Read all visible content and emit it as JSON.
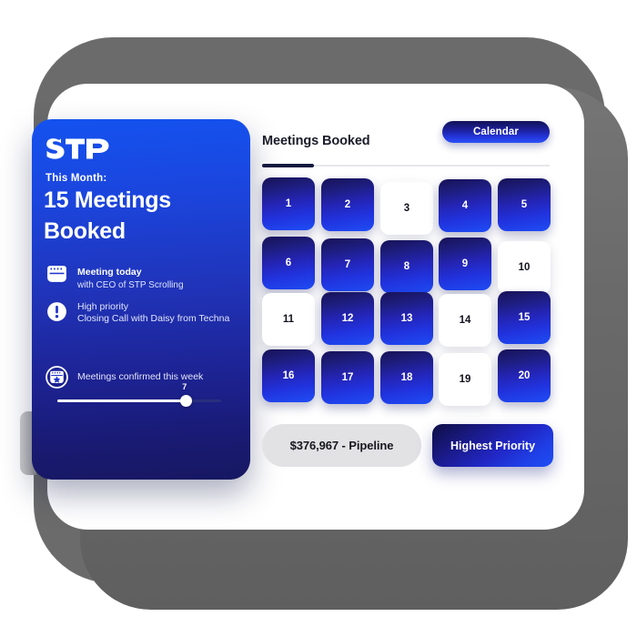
{
  "device": {
    "side_button_name": "power-button"
  },
  "sidebar": {
    "logo_text": "STP",
    "eyebrow": "This Month:",
    "headline": "15 Meetings Booked",
    "meeting_count": 15,
    "items": [
      {
        "icon": "calendar-icon",
        "title": "Meeting today",
        "subtitle": "with CEO of STP Scrolling"
      },
      {
        "icon": "exclamation-circle-icon",
        "title": "High priority",
        "subtitle": "Closing Call with Daisy from Techna"
      }
    ],
    "confirmed": {
      "icon": "calendar-star-icon",
      "label": "Meetings confirmed this week",
      "value": "7",
      "slider_percent": 79
    }
  },
  "panel": {
    "title": "Meetings Booked",
    "calendar_button": "Calendar",
    "progress_percent": 18,
    "footer": {
      "pipeline_label": "$376,967 - Pipeline",
      "priority_label": "Highest Priority"
    }
  },
  "calendar": {
    "columns": 5,
    "rows": 4,
    "days": [
      {
        "label": "1",
        "booked": true
      },
      {
        "label": "2",
        "booked": true
      },
      {
        "label": "3",
        "booked": false
      },
      {
        "label": "4",
        "booked": true
      },
      {
        "label": "5",
        "booked": true
      },
      {
        "label": "6",
        "booked": true
      },
      {
        "label": "7",
        "booked": true
      },
      {
        "label": "8",
        "booked": true
      },
      {
        "label": "9",
        "booked": true
      },
      {
        "label": "10",
        "booked": false
      },
      {
        "label": "11",
        "booked": false
      },
      {
        "label": "12",
        "booked": true
      },
      {
        "label": "13",
        "booked": true
      },
      {
        "label": "14",
        "booked": false
      },
      {
        "label": "15",
        "booked": true
      },
      {
        "label": "16",
        "booked": true
      },
      {
        "label": "17",
        "booked": true
      },
      {
        "label": "18",
        "booked": true
      },
      {
        "label": "19",
        "booked": false
      },
      {
        "label": "20",
        "booked": true
      }
    ]
  },
  "colors": {
    "brand_blue": "#1452ef",
    "deep_navy": "#171862",
    "bezel_gray": "#6b6b6b",
    "pill_gray": "#e2e2e4",
    "rule_active": "#151a3f"
  }
}
